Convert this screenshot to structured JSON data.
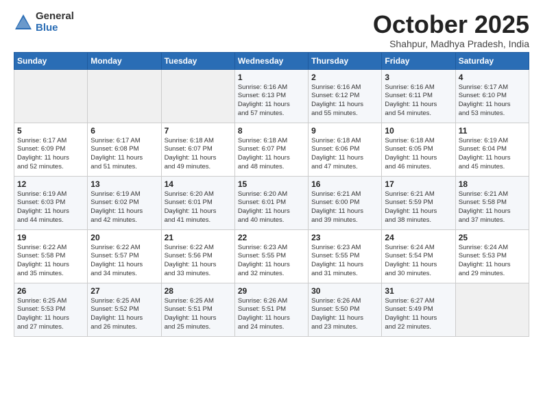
{
  "header": {
    "logo_general": "General",
    "logo_blue": "Blue",
    "month_title": "October 2025",
    "subtitle": "Shahpur, Madhya Pradesh, India"
  },
  "days_of_week": [
    "Sunday",
    "Monday",
    "Tuesday",
    "Wednesday",
    "Thursday",
    "Friday",
    "Saturday"
  ],
  "weeks": [
    [
      {
        "day": "",
        "info": ""
      },
      {
        "day": "",
        "info": ""
      },
      {
        "day": "",
        "info": ""
      },
      {
        "day": "1",
        "info": "Sunrise: 6:16 AM\nSunset: 6:13 PM\nDaylight: 11 hours\nand 57 minutes."
      },
      {
        "day": "2",
        "info": "Sunrise: 6:16 AM\nSunset: 6:12 PM\nDaylight: 11 hours\nand 55 minutes."
      },
      {
        "day": "3",
        "info": "Sunrise: 6:16 AM\nSunset: 6:11 PM\nDaylight: 11 hours\nand 54 minutes."
      },
      {
        "day": "4",
        "info": "Sunrise: 6:17 AM\nSunset: 6:10 PM\nDaylight: 11 hours\nand 53 minutes."
      }
    ],
    [
      {
        "day": "5",
        "info": "Sunrise: 6:17 AM\nSunset: 6:09 PM\nDaylight: 11 hours\nand 52 minutes."
      },
      {
        "day": "6",
        "info": "Sunrise: 6:17 AM\nSunset: 6:08 PM\nDaylight: 11 hours\nand 51 minutes."
      },
      {
        "day": "7",
        "info": "Sunrise: 6:18 AM\nSunset: 6:07 PM\nDaylight: 11 hours\nand 49 minutes."
      },
      {
        "day": "8",
        "info": "Sunrise: 6:18 AM\nSunset: 6:07 PM\nDaylight: 11 hours\nand 48 minutes."
      },
      {
        "day": "9",
        "info": "Sunrise: 6:18 AM\nSunset: 6:06 PM\nDaylight: 11 hours\nand 47 minutes."
      },
      {
        "day": "10",
        "info": "Sunrise: 6:18 AM\nSunset: 6:05 PM\nDaylight: 11 hours\nand 46 minutes."
      },
      {
        "day": "11",
        "info": "Sunrise: 6:19 AM\nSunset: 6:04 PM\nDaylight: 11 hours\nand 45 minutes."
      }
    ],
    [
      {
        "day": "12",
        "info": "Sunrise: 6:19 AM\nSunset: 6:03 PM\nDaylight: 11 hours\nand 44 minutes."
      },
      {
        "day": "13",
        "info": "Sunrise: 6:19 AM\nSunset: 6:02 PM\nDaylight: 11 hours\nand 42 minutes."
      },
      {
        "day": "14",
        "info": "Sunrise: 6:20 AM\nSunset: 6:01 PM\nDaylight: 11 hours\nand 41 minutes."
      },
      {
        "day": "15",
        "info": "Sunrise: 6:20 AM\nSunset: 6:01 PM\nDaylight: 11 hours\nand 40 minutes."
      },
      {
        "day": "16",
        "info": "Sunrise: 6:21 AM\nSunset: 6:00 PM\nDaylight: 11 hours\nand 39 minutes."
      },
      {
        "day": "17",
        "info": "Sunrise: 6:21 AM\nSunset: 5:59 PM\nDaylight: 11 hours\nand 38 minutes."
      },
      {
        "day": "18",
        "info": "Sunrise: 6:21 AM\nSunset: 5:58 PM\nDaylight: 11 hours\nand 37 minutes."
      }
    ],
    [
      {
        "day": "19",
        "info": "Sunrise: 6:22 AM\nSunset: 5:58 PM\nDaylight: 11 hours\nand 35 minutes."
      },
      {
        "day": "20",
        "info": "Sunrise: 6:22 AM\nSunset: 5:57 PM\nDaylight: 11 hours\nand 34 minutes."
      },
      {
        "day": "21",
        "info": "Sunrise: 6:22 AM\nSunset: 5:56 PM\nDaylight: 11 hours\nand 33 minutes."
      },
      {
        "day": "22",
        "info": "Sunrise: 6:23 AM\nSunset: 5:55 PM\nDaylight: 11 hours\nand 32 minutes."
      },
      {
        "day": "23",
        "info": "Sunrise: 6:23 AM\nSunset: 5:55 PM\nDaylight: 11 hours\nand 31 minutes."
      },
      {
        "day": "24",
        "info": "Sunrise: 6:24 AM\nSunset: 5:54 PM\nDaylight: 11 hours\nand 30 minutes."
      },
      {
        "day": "25",
        "info": "Sunrise: 6:24 AM\nSunset: 5:53 PM\nDaylight: 11 hours\nand 29 minutes."
      }
    ],
    [
      {
        "day": "26",
        "info": "Sunrise: 6:25 AM\nSunset: 5:53 PM\nDaylight: 11 hours\nand 27 minutes."
      },
      {
        "day": "27",
        "info": "Sunrise: 6:25 AM\nSunset: 5:52 PM\nDaylight: 11 hours\nand 26 minutes."
      },
      {
        "day": "28",
        "info": "Sunrise: 6:25 AM\nSunset: 5:51 PM\nDaylight: 11 hours\nand 25 minutes."
      },
      {
        "day": "29",
        "info": "Sunrise: 6:26 AM\nSunset: 5:51 PM\nDaylight: 11 hours\nand 24 minutes."
      },
      {
        "day": "30",
        "info": "Sunrise: 6:26 AM\nSunset: 5:50 PM\nDaylight: 11 hours\nand 23 minutes."
      },
      {
        "day": "31",
        "info": "Sunrise: 6:27 AM\nSunset: 5:49 PM\nDaylight: 11 hours\nand 22 minutes."
      },
      {
        "day": "",
        "info": ""
      }
    ]
  ]
}
